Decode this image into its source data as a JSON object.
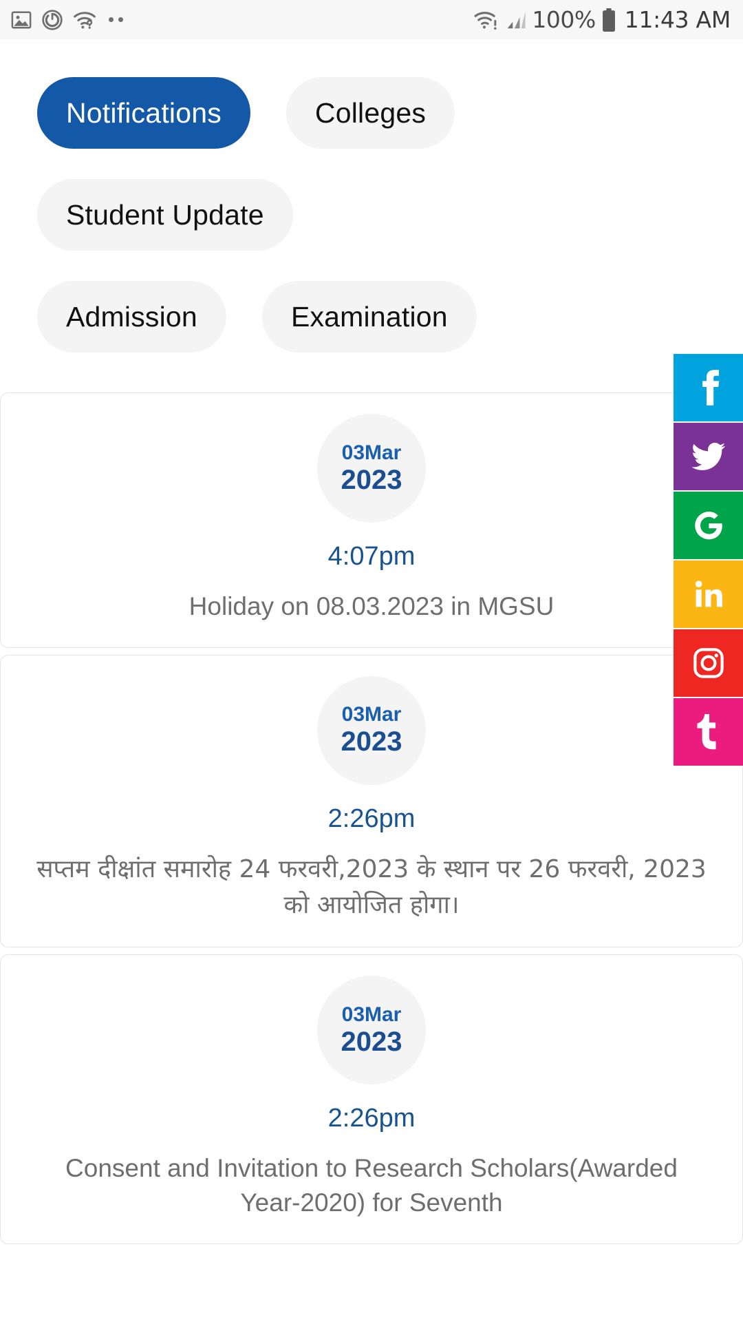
{
  "status_bar": {
    "left_icons": [
      "image-icon",
      "do-not-disturb-icon",
      "wifi-question-icon",
      "more-dots-icon"
    ],
    "right_icons": [
      "wifi-alert-icon",
      "signal-bars-icon",
      "battery-icon"
    ],
    "battery_percent": "100%",
    "time": "11:43 AM"
  },
  "tabs": [
    {
      "label": "Notifications",
      "active": true
    },
    {
      "label": "Colleges",
      "active": false
    },
    {
      "label": "Student Update",
      "active": false
    },
    {
      "label": "Admission",
      "active": false
    },
    {
      "label": "Examination",
      "active": false
    }
  ],
  "notifications": [
    {
      "date_day_month": "03Mar",
      "date_year": "2023",
      "time": "4:07pm",
      "title": "Holiday on 08.03.2023 in MGSU",
      "lang": "en"
    },
    {
      "date_day_month": "03Mar",
      "date_year": "2023",
      "time": "2:26pm",
      "title": "सप्तम दीक्षांत समारोह 24 फरवरी,2023 के स्थान पर 26 फरवरी, 2023 को आयोजित होगा।",
      "lang": "hi"
    },
    {
      "date_day_month": "03Mar",
      "date_year": "2023",
      "time": "2:26pm",
      "title": "Consent and Invitation to Research Scholars(Awarded Year-2020) for Seventh",
      "lang": "en"
    }
  ],
  "social_links": [
    {
      "name": "facebook",
      "glyph": "f",
      "color": "#00a3dd"
    },
    {
      "name": "twitter",
      "glyph": "t",
      "color": "#7b3296"
    },
    {
      "name": "google",
      "glyph": "G",
      "color": "#00a44b"
    },
    {
      "name": "linkedin",
      "glyph": "in",
      "color": "#fbb614"
    },
    {
      "name": "instagram",
      "glyph": "o",
      "color": "#ee2722"
    },
    {
      "name": "tumblr",
      "glyph": "t",
      "color": "#ec1c7f"
    }
  ],
  "colors": {
    "active_tab_bg": "#1458a8",
    "inactive_tab_bg": "#f4f4f4",
    "date_text": "#1a5fae",
    "time_text": "#17538f",
    "title_text": "#6e6e6e",
    "status_bar_bg": "#f7f7f7",
    "card_border": "#e4e4e4"
  }
}
